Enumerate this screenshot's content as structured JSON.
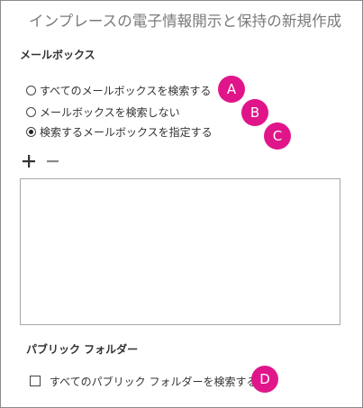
{
  "dialog": {
    "title": "インプレースの電子情報開示と保持の新規作成"
  },
  "mailboxes": {
    "heading": "メールボックス",
    "options": [
      {
        "label": "すべてのメールボックスを検索する",
        "checked": false,
        "callout": "A"
      },
      {
        "label": "メールボックスを検索しない",
        "checked": false,
        "callout": "B"
      },
      {
        "label": "検索するメールボックスを指定する",
        "checked": true,
        "callout": "C"
      }
    ],
    "toolbar": {
      "add_icon": "plus-icon",
      "remove_icon": "minus-icon"
    }
  },
  "public_folders": {
    "heading": "パブリック フォルダー",
    "checkbox_label": "すべてのパブリック フォルダーを検索する",
    "checked": false,
    "callout": "D"
  },
  "colors": {
    "callout": "#e0158a",
    "title": "#7a7a7a",
    "text": "#333333",
    "border": "#a8a8a8"
  }
}
